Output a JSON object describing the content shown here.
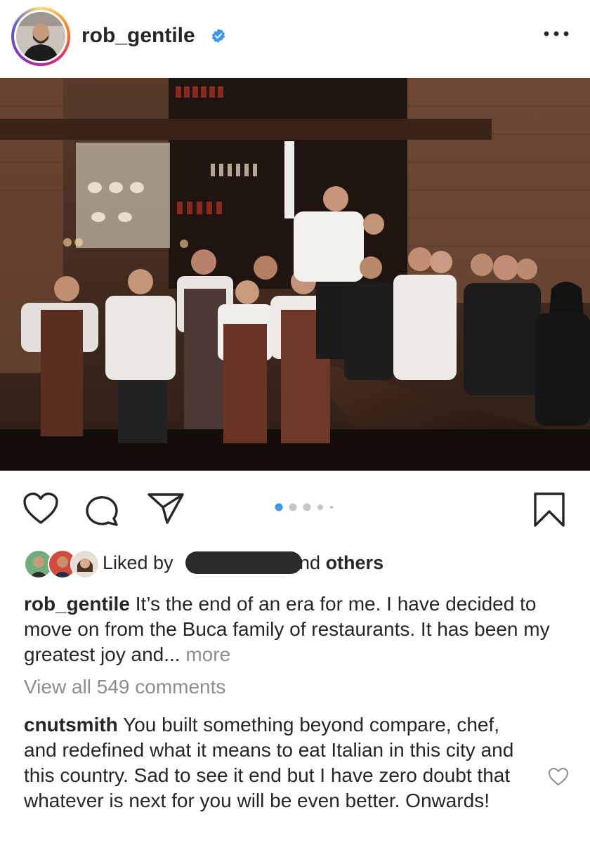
{
  "header": {
    "username": "rob_gentile",
    "verified_icon": "verified-badge-icon",
    "more_icon": "more-options-icon"
  },
  "post": {
    "image_description_icon": "restaurant-team-photo",
    "carousel": {
      "total": 5,
      "active": 1
    }
  },
  "actions": {
    "like_icon": "heart-icon",
    "comment_icon": "comment-icon",
    "share_icon": "share-icon",
    "save_icon": "bookmark-icon"
  },
  "likes": {
    "prefix": "Liked by",
    "suffix_fragment": "nd",
    "others": "others"
  },
  "caption": {
    "username": "rob_gentile",
    "text": "It’s the end of an era for me. I have decided to move on from the Buca family of restaurants. It has been my greatest joy and...",
    "more": "more"
  },
  "comments": {
    "view_all": "View all 549 comments",
    "items": [
      {
        "username": "cnutsmith",
        "text": "You built something beyond compare, chef, and redefined what it means to eat Italian in this city and this country. Sad to see it end but I have zero doubt that whatever is next for you will be even better. Onwards!"
      }
    ]
  },
  "colors": {
    "verified": "#3897f0",
    "carousel_active": "#3897f0",
    "carousel_inactive": "#c7c7c7",
    "secondary_text": "#8e8e8e"
  }
}
